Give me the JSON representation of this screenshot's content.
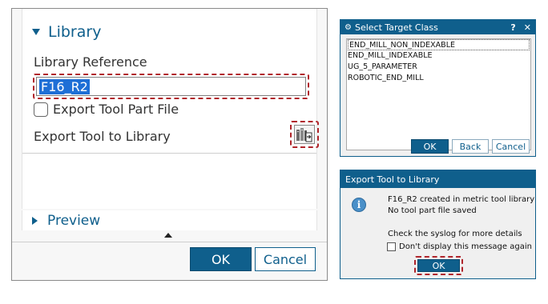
{
  "left_panel": {
    "library": {
      "title": "Library",
      "reference_label": "Library Reference",
      "reference_value": "F16_R2",
      "export_part_label": "Export Tool Part File",
      "export_part_checked": false,
      "export_to_library_label": "Export Tool to Library",
      "export_icon": "export-library-icon"
    },
    "preview": {
      "title": "Preview"
    },
    "buttons": {
      "ok": "OK",
      "cancel": "Cancel"
    }
  },
  "select_target_class": {
    "title": "Select Target Class",
    "help": "?",
    "close": "✕",
    "items": [
      "END_MILL_NON_INDEXABLE",
      "END_MILL_INDEXABLE",
      "UG_5_PARAMETER",
      "ROBOTIC_END_MILL"
    ],
    "selected_index": 0,
    "buttons": {
      "ok": "OK",
      "back": "Back",
      "cancel": "Cancel"
    }
  },
  "message_dialog": {
    "title": "Export Tool to Library",
    "icon": "info-icon",
    "line1": "F16_R2 created in metric tool library",
    "line2": "No tool part file saved",
    "line3": "Check the syslog for more details",
    "dont_display_label": "Don't display this message again",
    "dont_display_checked": false,
    "ok": "OK"
  },
  "colors": {
    "accent": "#0f5f8c",
    "highlight_dash": "#b0252b",
    "selection": "#1e6fd6"
  }
}
